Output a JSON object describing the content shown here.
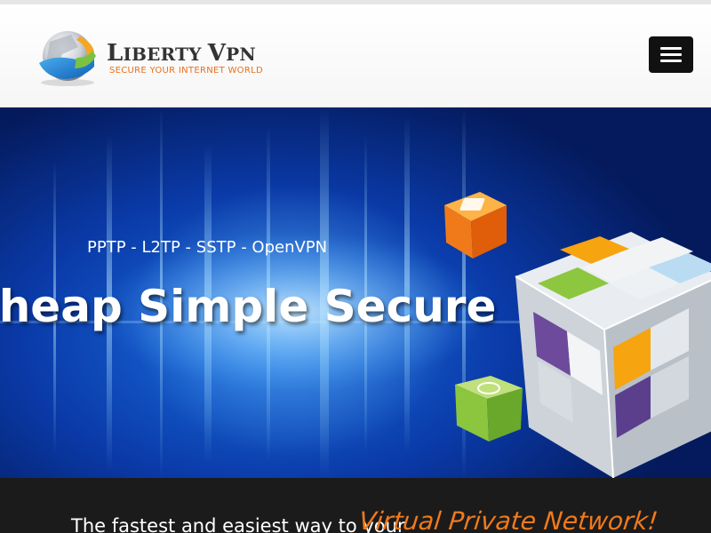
{
  "header": {
    "logo": {
      "title_first": "L",
      "title_rest": "IBERTY ",
      "title_v": "V",
      "title_end": "PN",
      "subtitle": "SECURE YOUR INTERNET WORLD",
      "icon": "globe-icon"
    },
    "menu_button": {
      "icon": "hamburger-menu-icon"
    }
  },
  "hero": {
    "protocols": "PPTP - L2TP - SSTP - OpenVPN",
    "tagline": "Cheap Simple Secure",
    "art": "3d-cube-illustration"
  },
  "banner": {
    "lead_text": "The fastest and easiest way to your",
    "accent_text": "Virtual Private Network!"
  },
  "colors": {
    "accent": "#f07a1a",
    "hero_blue": "#1a6fe0",
    "banner_bg": "#1b1b1b"
  }
}
